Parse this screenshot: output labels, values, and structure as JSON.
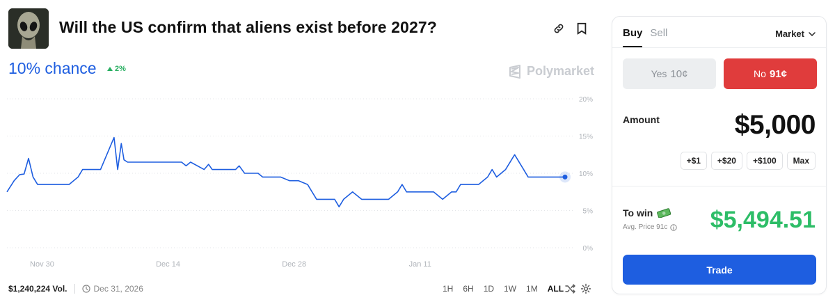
{
  "header": {
    "title": "Will the US confirm that aliens exist before 2027?",
    "chance": "10% chance",
    "delta": "2%",
    "brand": "Polymarket"
  },
  "footer": {
    "volume": "$1,240,224 Vol.",
    "end_date": "Dec 31, 2026",
    "ranges": [
      "1H",
      "6H",
      "1D",
      "1W",
      "1M",
      "ALL"
    ],
    "active_range": "ALL"
  },
  "panel": {
    "tab_buy": "Buy",
    "tab_sell": "Sell",
    "order_type": "Market",
    "yes_label": "Yes",
    "yes_price": "10¢",
    "no_label": "No",
    "no_price": "91¢",
    "amount_label": "Amount",
    "amount_value": "$5,000",
    "chips": [
      "+$1",
      "+$20",
      "+$100",
      "Max"
    ],
    "to_win_label": "To win",
    "avg_price": "Avg. Price 91c",
    "to_win_value": "$5,494.51",
    "trade_label": "Trade"
  },
  "colors": {
    "accent": "#1e5ee0",
    "no": "#e03c3c",
    "win": "#2dbd67",
    "up": "#27ae60"
  },
  "icons": {
    "link": "link-icon",
    "bookmark": "bookmark-icon",
    "clock": "clock-icon",
    "shuffle": "shuffle-icon",
    "settings": "gear-icon",
    "info": "info-icon",
    "money": "money-icon"
  },
  "chart_data": {
    "type": "line",
    "title": "",
    "xlabel": "",
    "ylabel": "",
    "ylim": [
      0,
      20
    ],
    "yticks": [
      "0%",
      "5%",
      "10%",
      "15%",
      "20%"
    ],
    "xticks": [
      "Nov 30",
      "Dec 14",
      "Dec 28",
      "Jan 11"
    ],
    "grid": true,
    "series": [
      {
        "color": "#1e5ee0",
        "x": [
          0,
          0.8,
          1.4,
          1.9,
          2.4,
          2.9,
          3.4,
          3.9,
          4.4,
          5.4,
          6.9,
          7.9,
          8.4,
          9.4,
          10.4,
          11.9,
          12.3,
          12.7,
          13.0,
          13.4,
          14.4,
          15.4,
          16.9,
          18.4,
          19.4,
          19.9,
          20.4,
          21.9,
          22.4,
          22.8,
          23.4,
          24.4,
          25.4,
          25.8,
          26.4,
          27.4,
          27.9,
          28.4,
          29.4,
          30.4,
          31.4,
          32.4,
          33.4,
          33.9,
          34.4,
          35.4,
          36.4,
          36.9,
          37.4,
          38.4,
          39.4,
          40.4,
          41.4,
          42.4,
          43.4,
          43.9,
          44.4,
          45.4,
          46.4,
          47.4,
          48.4,
          49.4,
          49.9,
          50.4,
          51.4,
          52.4,
          53.4,
          53.9,
          54.4,
          55.4,
          56.4,
          57.4,
          57.9,
          58.4,
          59.4,
          60.4,
          61.4,
          62.0
        ],
        "values": [
          7.5,
          9.0,
          9.8,
          9.9,
          12.0,
          9.5,
          8.5,
          8.5,
          8.5,
          8.5,
          8.5,
          9.5,
          10.5,
          10.5,
          10.5,
          14.8,
          10.5,
          14.0,
          11.8,
          11.5,
          11.5,
          11.5,
          11.5,
          11.5,
          11.5,
          11.0,
          11.5,
          10.5,
          11.2,
          10.5,
          10.5,
          10.5,
          10.5,
          11.0,
          10.0,
          10.0,
          10.0,
          9.5,
          9.5,
          9.5,
          9.0,
          9.0,
          8.5,
          7.5,
          6.5,
          6.5,
          6.5,
          5.5,
          6.5,
          7.5,
          6.5,
          6.5,
          6.5,
          6.5,
          7.5,
          8.5,
          7.5,
          7.5,
          7.5,
          7.5,
          6.5,
          7.5,
          7.5,
          8.5,
          8.5,
          8.5,
          9.5,
          10.5,
          9.5,
          10.5,
          12.5,
          10.5,
          9.5,
          9.5,
          9.5,
          9.5,
          9.5,
          9.5
        ]
      }
    ]
  }
}
